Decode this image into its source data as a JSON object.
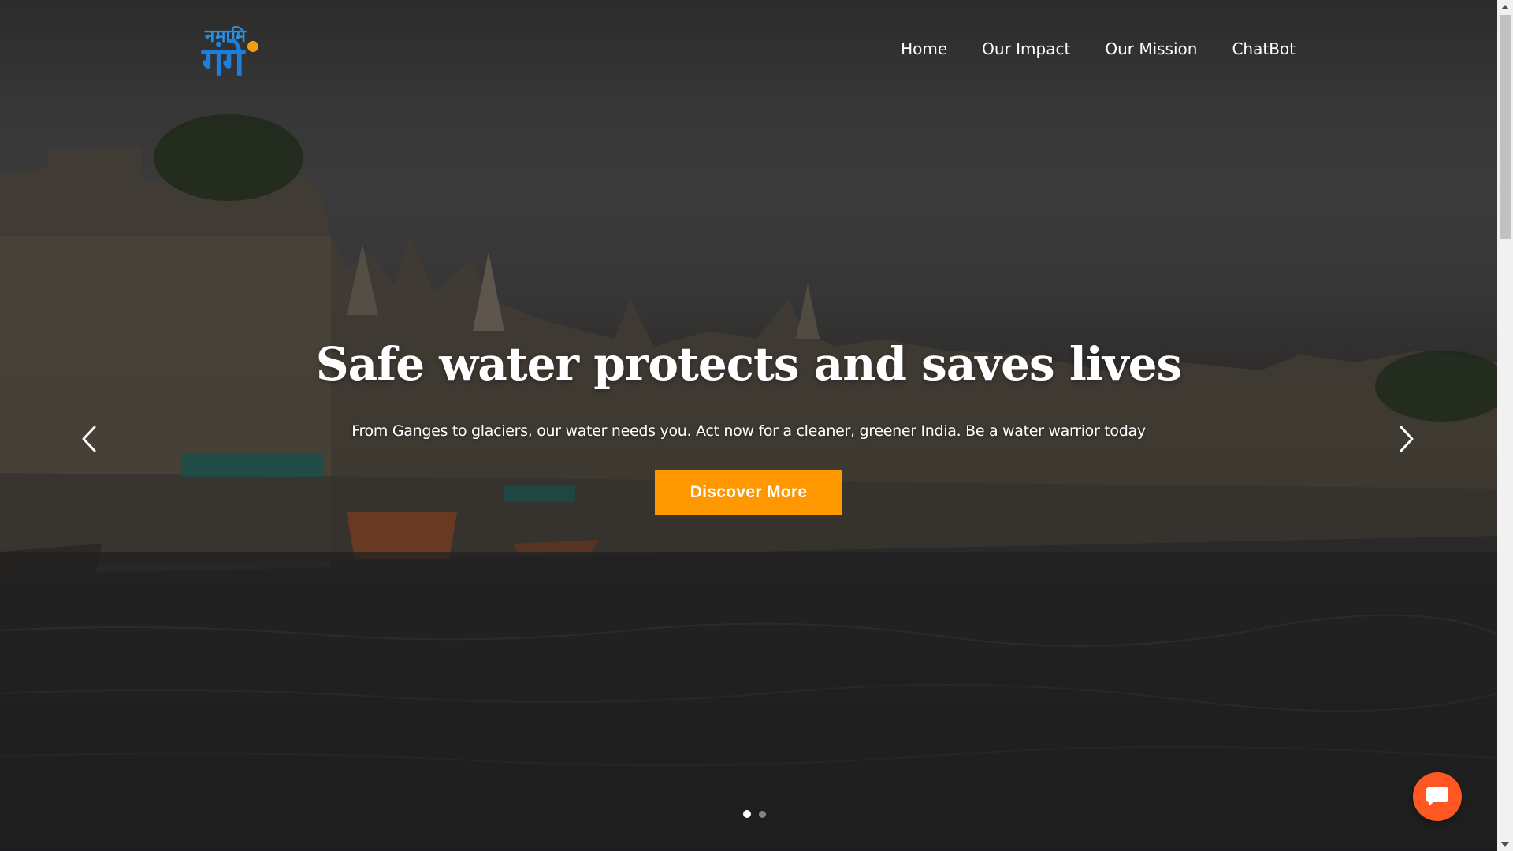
{
  "logo": {
    "top_text": "नमामि",
    "bottom_text": "गंगे"
  },
  "nav": {
    "items": [
      {
        "label": "Home"
      },
      {
        "label": "Our Impact"
      },
      {
        "label": "Our Mission"
      },
      {
        "label": "ChatBot"
      }
    ]
  },
  "hero": {
    "title": "Safe water protects and saves lives",
    "subtitle": "From Ganges to glaciers, our water needs you. Act now for a cleaner, greener India. Be a water warrior today",
    "cta_label": "Discover More",
    "slides_total": 2,
    "active_slide": 1
  },
  "icons": {
    "prev": "chevron-left-icon",
    "next": "chevron-right-icon",
    "chat": "chat-bubble-icon"
  },
  "colors": {
    "accent": "#ff9800",
    "chat_fab": "#ff5722",
    "logo_blue": "#1e7fd8",
    "logo_orange": "#f39c12",
    "text": "#ffffff"
  }
}
